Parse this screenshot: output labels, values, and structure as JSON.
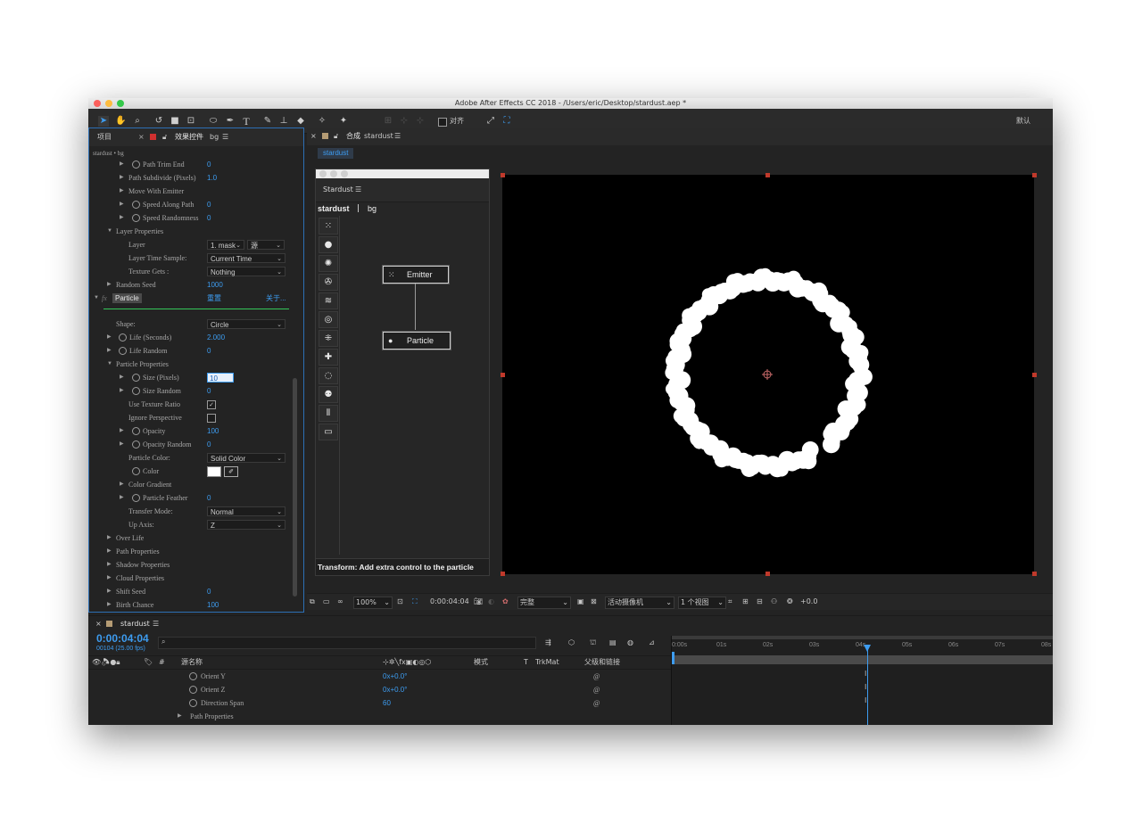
{
  "window": {
    "title": "Adobe After Effects CC 2018 - /Users/eric/Desktop/stardust.aep *"
  },
  "toolbar": {
    "align_label": "对齐",
    "workspace_label": "默认"
  },
  "left_panel": {
    "tab_project": "项目",
    "tab_effects": "效果控件",
    "tab_effects_layer": "bg",
    "breadcrumb": "stardust • bg",
    "rows": [
      {
        "label": "Path Trim End",
        "value": "0"
      },
      {
        "label": "Path Subdivide (Pixels)",
        "value": "1.0"
      },
      {
        "label": "Move With Emitter",
        "value": ""
      },
      {
        "label": "Speed Along Path",
        "value": "0"
      },
      {
        "label": "Speed Randomness",
        "value": "0"
      },
      {
        "label": "Layer Properties",
        "value": ""
      },
      {
        "label": "Layer",
        "value": ""
      },
      {
        "label": "Layer Time Sample:",
        "value": ""
      },
      {
        "label": "Texture Gets :",
        "value": ""
      },
      {
        "label": "Random Seed",
        "value": "1000"
      }
    ],
    "layer_dropdown": "1. mask",
    "layer_source_dropdown": "源",
    "layer_time_sample_dropdown": "Current Time",
    "texture_gets_dropdown": "Nothing",
    "fx_label": "fx",
    "particle_effect": {
      "name": "Particle",
      "reset": "重置",
      "about": "关于..."
    },
    "particle_rows": [
      {
        "label": "Shape:",
        "value": ""
      },
      {
        "label": "Life (Seconds)",
        "value": "2.000"
      },
      {
        "label": "Life Random",
        "value": "0"
      },
      {
        "label": "Particle Properties",
        "value": ""
      },
      {
        "label": "Size (Pixels)",
        "value": "10"
      },
      {
        "label": "Size Random",
        "value": "0"
      },
      {
        "label": "Use Texture Ratio",
        "value": ""
      },
      {
        "label": "Ignore Perspective",
        "value": ""
      },
      {
        "label": "Opacity",
        "value": "100"
      },
      {
        "label": "Opacity Random",
        "value": "0"
      },
      {
        "label": "Particle Color:",
        "value": ""
      },
      {
        "label": "Color",
        "value": ""
      },
      {
        "label": "Color Gradient",
        "value": ""
      },
      {
        "label": "Particle Feather",
        "value": "0"
      },
      {
        "label": "Transfer Mode:",
        "value": ""
      },
      {
        "label": "Up Axis:",
        "value": ""
      },
      {
        "label": "Over Life",
        "value": ""
      },
      {
        "label": "Path Properties",
        "value": ""
      },
      {
        "label": "Shadow Properties",
        "value": ""
      },
      {
        "label": "Cloud Properties",
        "value": ""
      },
      {
        "label": "Shift Seed",
        "value": "0"
      },
      {
        "label": "Birth Chance",
        "value": "100"
      }
    ],
    "shape_dropdown": "Circle",
    "particle_color_dropdown": "Solid Color",
    "transfer_mode_dropdown": "Normal",
    "up_axis_dropdown": "Z",
    "use_texture_ratio_checked": "✓",
    "particle_color_hex": "#ffffff"
  },
  "comp_panel": {
    "tab_prefix": "合成",
    "comp_name": "stardust",
    "subtab": "stardust"
  },
  "stardust_panel": {
    "title": "Stardust",
    "breadcrumb_comp": "stardust",
    "breadcrumb_sep": "|",
    "breadcrumb_layer": "bg",
    "nodes": {
      "emitter": "Emitter",
      "particle": "Particle"
    },
    "status": "Transform: Add extra control to the particle",
    "tools": [
      "emitter-icon",
      "particle-icon",
      "burst-icon",
      "fan-icon",
      "wave-icon",
      "target-icon",
      "grid-icon",
      "plus-icon",
      "dashed-circle-icon",
      "cluster-icon",
      "wind-icon",
      "frame-icon"
    ]
  },
  "viewer_bar": {
    "zoom": "100%",
    "timecode": "0:00:04:04",
    "resolution": "完整",
    "camera": "活动摄像机",
    "views": "1 个视图",
    "exposure": "+0.0"
  },
  "timeline": {
    "tab": "stardust",
    "current_time": "0:00:04:04",
    "frame_info": "00104 (25.00 fps)",
    "search_placeholder": "",
    "col_hash": "#",
    "col_source_name": "源名称",
    "col_mode": "模式",
    "col_t": "T",
    "col_trkmat": "TrkMat",
    "col_parent": "父级和链接",
    "rows": [
      {
        "label": "Orient Y",
        "value": "0x+0.0°"
      },
      {
        "label": "Orient Z",
        "value": "0x+0.0°"
      },
      {
        "label": "Direction Span",
        "value": "60"
      },
      {
        "label": "Path Properties",
        "value": ""
      }
    ],
    "ruler_labels": [
      "0:00s",
      "01s",
      "02s",
      "03s",
      "04s",
      "05s",
      "06s",
      "07s",
      "08s"
    ]
  },
  "colors": {
    "accent_blue": "#3d9cf0",
    "playhead": "#3d9cf0",
    "green_line": "#34c759",
    "handle_red": "#c0392b"
  }
}
